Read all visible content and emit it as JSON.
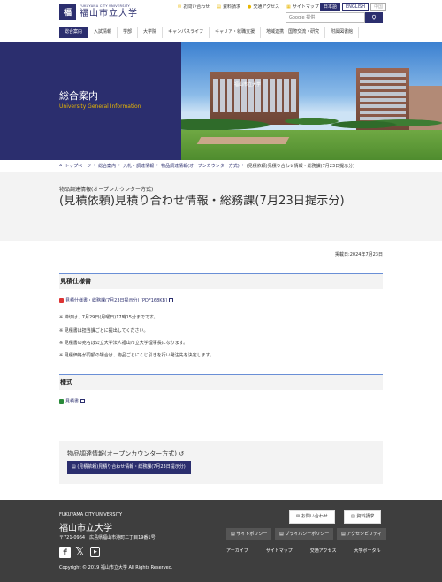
{
  "header": {
    "logo_en": "FUKUYAMA CITY UNIVERSITY",
    "logo_ja": "福山市立大学",
    "util_links": [
      {
        "icon": "mail-icon",
        "label": "お問い合わせ"
      },
      {
        "icon": "document-icon",
        "label": "資料請求"
      },
      {
        "icon": "location-pin-icon",
        "label": "交通アクセス"
      },
      {
        "icon": "sitemap-icon",
        "label": "サイトマップ"
      }
    ],
    "lang": {
      "ja": "日本語",
      "en": "ENGLISH",
      "other": "中国"
    },
    "search": {
      "placeholder": "Google 提供"
    },
    "nav": [
      "総合案内",
      "入試情報",
      "学部",
      "大学院",
      "キャンパスライフ",
      "キャリア・就職支援",
      "地域連携・国際交流・研究",
      "附属図書館"
    ]
  },
  "hero": {
    "title": "総合案内",
    "subtitle": "University General Information",
    "building_sign": "福山市立大学"
  },
  "breadcrumb": [
    "トップページ",
    "総合案内",
    "入札・調達情報",
    "物品調達情報(オープンカウンター方式)",
    "(見積依頼)見積り合わせ情報・総務課(7月23日提示分)"
  ],
  "page": {
    "category": "物品調達情報(オープンカウンター方式)",
    "title": "(見積依頼)見積り合わせ情報・総務課(7月23日提示分)",
    "posted": "掲載日:2024年7月23日"
  },
  "sections": {
    "spec_title": "見積仕様書",
    "spec_link": "見積仕様書・総務課(7月23日提示分) [PDF168KB]",
    "notes": [
      "※ 締切は、7月29日(月曜日)17時15分までです。",
      "※ 見積書は担当課ごとに提出してください。",
      "※ 見積書の宛名は公立大学法人福山市立大学理事長になります。",
      "※ 見積価格が同額の場合は、物品ごとにくじ引きを行い発注先を決定します。"
    ],
    "form_title": "様式",
    "form_link": "見積書"
  },
  "related": {
    "title": "物品調達情報(オープンカウンター方式)",
    "button": "(見積依頼)見積り合わせ情報・総務課(7月23日提示分)"
  },
  "footer": {
    "name_en": "FUKUYAMA CITY UNIVERSITY",
    "name_ja": "福山市立大学",
    "address": "〒721-0964　広島県福山市港町二丁目19番1号",
    "sns": {
      "facebook": "f",
      "youtube": "▶"
    },
    "copyright": "Copyright © 2019 福山市立大学 All Rights Reserved.",
    "btn_contact": "お問い合わせ",
    "btn_request": "資料請求",
    "policy_links": [
      "サイトポリシー",
      "プライバシーポリシー",
      "アクセシビリティ"
    ],
    "links": [
      "アーカイブ",
      "サイトマップ",
      "交通アクセス",
      "大学ポータル"
    ]
  },
  "colors": {
    "primary": "#2b2e6e",
    "accent": "#e8b600",
    "footer_bg": "#3e3e3e",
    "section_border": "#6a8fd6"
  }
}
